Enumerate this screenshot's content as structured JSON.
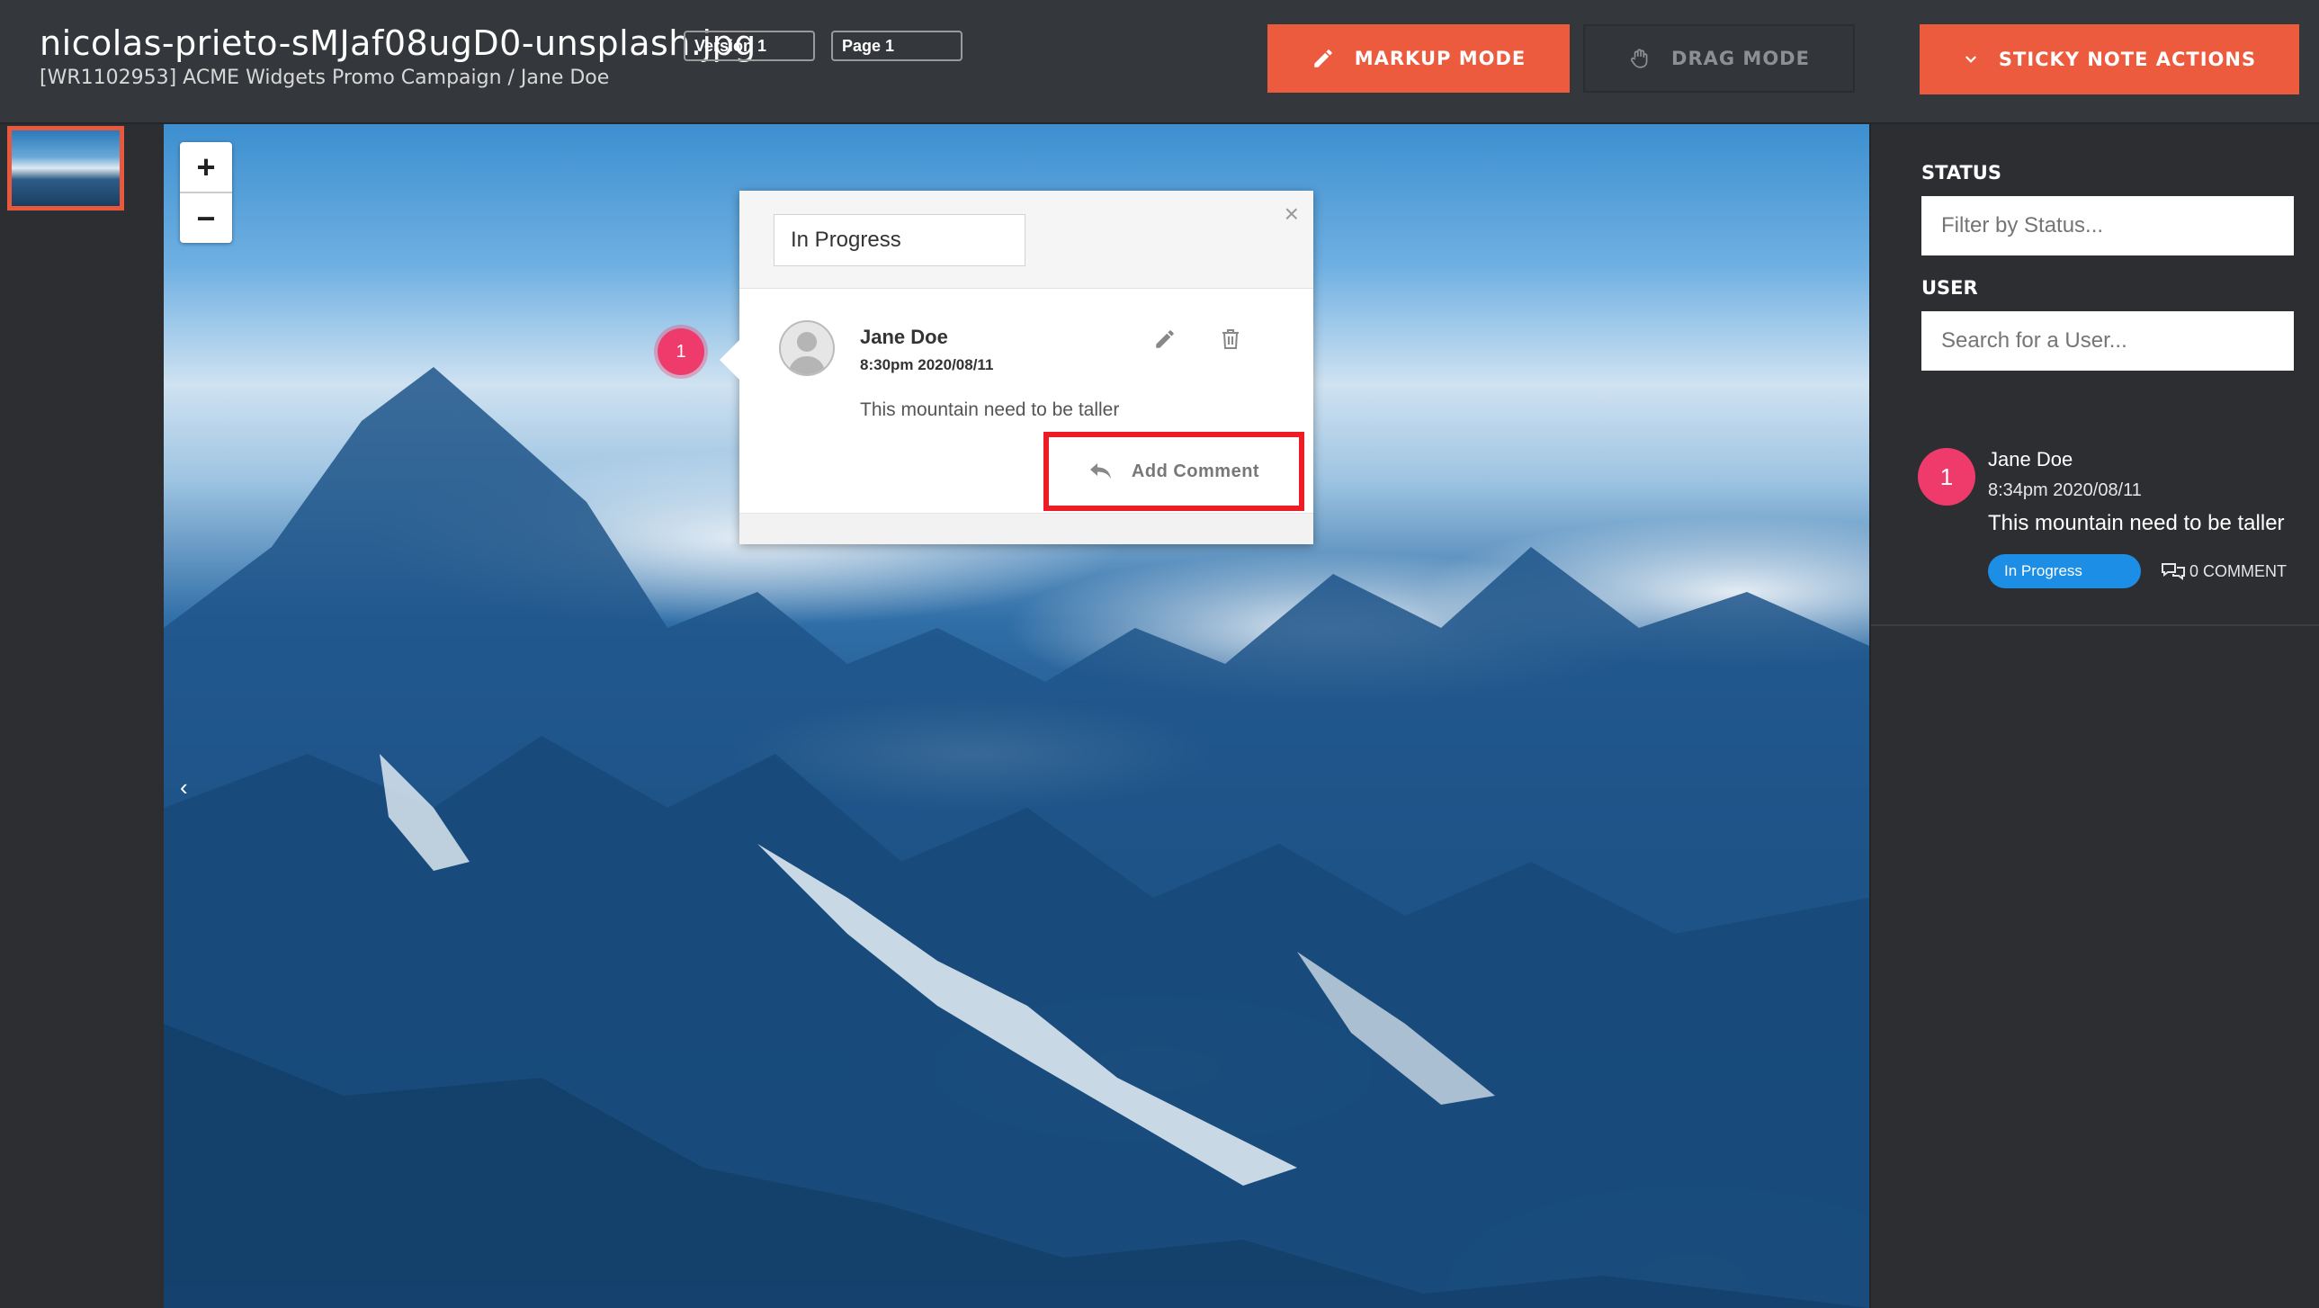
{
  "header": {
    "file_name": "nicolas-prieto-sMJaf08ugD0-unsplash.jpg",
    "breadcrumb": "[WR1102953] ACME Widgets Promo Campaign / Jane Doe",
    "version_select": "Version 1",
    "page_select": "Page 1",
    "markup_mode_label": "MARKUP MODE",
    "drag_mode_label": "DRAG MODE",
    "sticky_note_actions_label": "STICKY NOTE ACTIONS"
  },
  "canvas": {
    "zoom_in": "+",
    "zoom_out": "−",
    "prev_arrow": "‹",
    "pin_number": "1"
  },
  "popup": {
    "status": "In Progress",
    "close_glyph": "×",
    "author": "Jane Doe",
    "timestamp": "8:30pm 2020/08/11",
    "comment_text": "This mountain need to be taller",
    "add_comment_label": "Add Comment"
  },
  "sidebar": {
    "status_label": "STATUS",
    "status_placeholder": "Filter by Status...",
    "user_label": "USER",
    "user_placeholder": "Search for a User...",
    "items": [
      {
        "number": "1",
        "author": "Jane Doe",
        "timestamp": "8:34pm 2020/08/11",
        "text": "This mountain need to be taller",
        "status": "In Progress",
        "comment_count": "0 COMMENT"
      }
    ]
  },
  "colors": {
    "accent": "#ec5b3e",
    "pin": "#ef3b6b",
    "highlight_box": "#ee1c25",
    "status_badge": "#1d8ee5",
    "background": "#2c2e31"
  },
  "icons": [
    "pencil-icon",
    "hand-icon",
    "chevron-down-icon",
    "close-icon",
    "reply-icon",
    "trash-icon",
    "comments-icon",
    "avatar-icon"
  ]
}
